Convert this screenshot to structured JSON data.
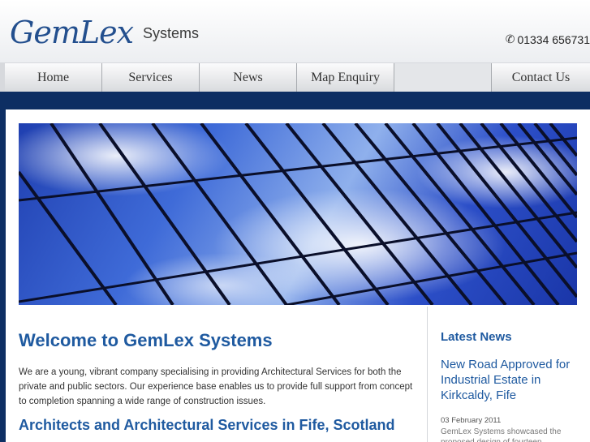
{
  "brand": {
    "logo_text": "GemLex",
    "logo_sub": "Systems",
    "phone": "01334 656731",
    "accent": "#1f5aa0",
    "dark_blue": "#0d2e63"
  },
  "nav": {
    "items": [
      {
        "label": "Home"
      },
      {
        "label": "Services"
      },
      {
        "label": "News"
      },
      {
        "label": "Map Enquiry"
      },
      {
        "label": "Contact Us"
      }
    ]
  },
  "main": {
    "welcome_title": "Welcome to GemLex Systems",
    "intro": "We are a young, vibrant company specialising in providing Architectural Services for both the private and public sectors. Our experience base enables us to provide full support from concept to completion spanning a wide range of construction issues.",
    "sub_heading": "Architects and Architectural Services in Fife, Scotland"
  },
  "sidebar": {
    "heading": "Latest News",
    "news": [
      {
        "title": "New Road Approved for Industrial Estate in Kirkcaldy, Fife",
        "date": "03 February 2011",
        "snippet": "GemLex Systems showcased the proposed design of fourteen"
      }
    ]
  }
}
